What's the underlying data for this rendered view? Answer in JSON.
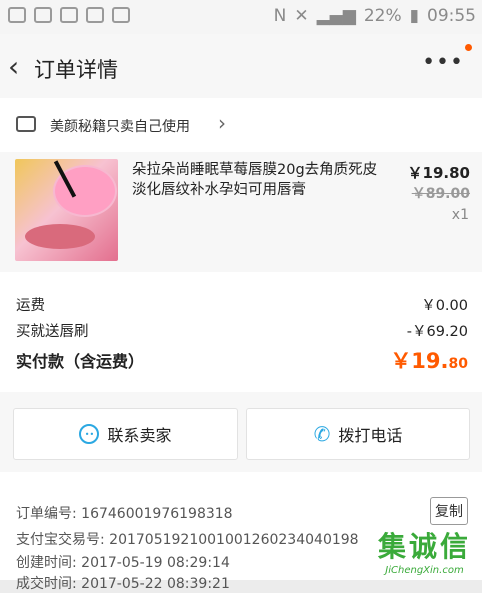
{
  "status_bar": {
    "battery": "22%",
    "time": "09:55"
  },
  "header": {
    "title": "订单详情",
    "back_icon": "back-chevron-icon",
    "more_icon": "more-dots-icon",
    "accent": "#ff5a00"
  },
  "shop": {
    "name": "美颜秘籍只卖自己使用"
  },
  "item": {
    "title": "朵拉朵尚睡眠草莓唇膜20g去角质死皮淡化唇纹补水孕妇可用唇膏",
    "price": "￥19.80",
    "original_price": "￥89.00",
    "quantity": "x1"
  },
  "fees": {
    "shipping_label": "运费",
    "shipping_value": "￥0.00",
    "gift_label": "买就送唇刷",
    "gift_value": "-￥69.20",
    "total_label": "实付款（含运费）",
    "total_value_main": "￥19.",
    "total_value_cents": "80"
  },
  "actions": {
    "contact_seller": "联系卖家",
    "call": "拨打电话"
  },
  "order_info": {
    "order_number": "订单编号: 16746001976198318",
    "alipay_number": "支付宝交易号: 2017051921001001260234040198",
    "created_time": "创建时间: 2017-05-19 08:29:14",
    "deal_time": "成交时间: 2017-05-22 08:39:21",
    "copy_label": "复制"
  },
  "watermark": {
    "text": "集诚信",
    "domain": "JiChengXin.com"
  }
}
